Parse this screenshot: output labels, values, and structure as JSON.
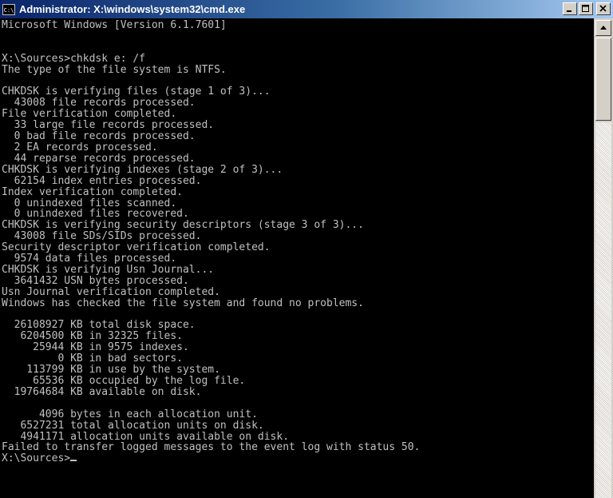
{
  "window": {
    "title": "Administrator: X:\\windows\\system32\\cmd.exe",
    "icon": "cmd-icon",
    "icon_text": "C:\\",
    "controls": [
      "minimize-icon",
      "maximize-icon",
      "close-icon"
    ]
  },
  "console": {
    "lines": [
      "Microsoft Windows [Version 6.1.7601]",
      "",
      "",
      "X:\\Sources>chkdsk e: /f",
      "The type of the file system is NTFS.",
      "",
      "CHKDSK is verifying files (stage 1 of 3)...",
      "  43008 file records processed.",
      "File verification completed.",
      "  33 large file records processed.",
      "  0 bad file records processed.",
      "  2 EA records processed.",
      "  44 reparse records processed.",
      "CHKDSK is verifying indexes (stage 2 of 3)...",
      "  62154 index entries processed.",
      "Index verification completed.",
      "  0 unindexed files scanned.",
      "  0 unindexed files recovered.",
      "CHKDSK is verifying security descriptors (stage 3 of 3)...",
      "  43008 file SDs/SIDs processed.",
      "Security descriptor verification completed.",
      "  9574 data files processed.",
      "CHKDSK is verifying Usn Journal...",
      "  3641432 USN bytes processed.",
      "Usn Journal verification completed.",
      "Windows has checked the file system and found no problems.",
      "",
      "  26108927 KB total disk space.",
      "   6204500 KB in 32325 files.",
      "     25944 KB in 9575 indexes.",
      "         0 KB in bad sectors.",
      "    113799 KB in use by the system.",
      "     65536 KB occupied by the log file.",
      "  19764684 KB available on disk.",
      "",
      "      4096 bytes in each allocation unit.",
      "   6527231 total allocation units on disk.",
      "   4941171 allocation units available on disk.",
      "Failed to transfer logged messages to the event log with status 50.",
      ""
    ],
    "prompt": "X:\\Sources>"
  },
  "scrollbar": {
    "up_icon": "arrow-up-icon"
  }
}
